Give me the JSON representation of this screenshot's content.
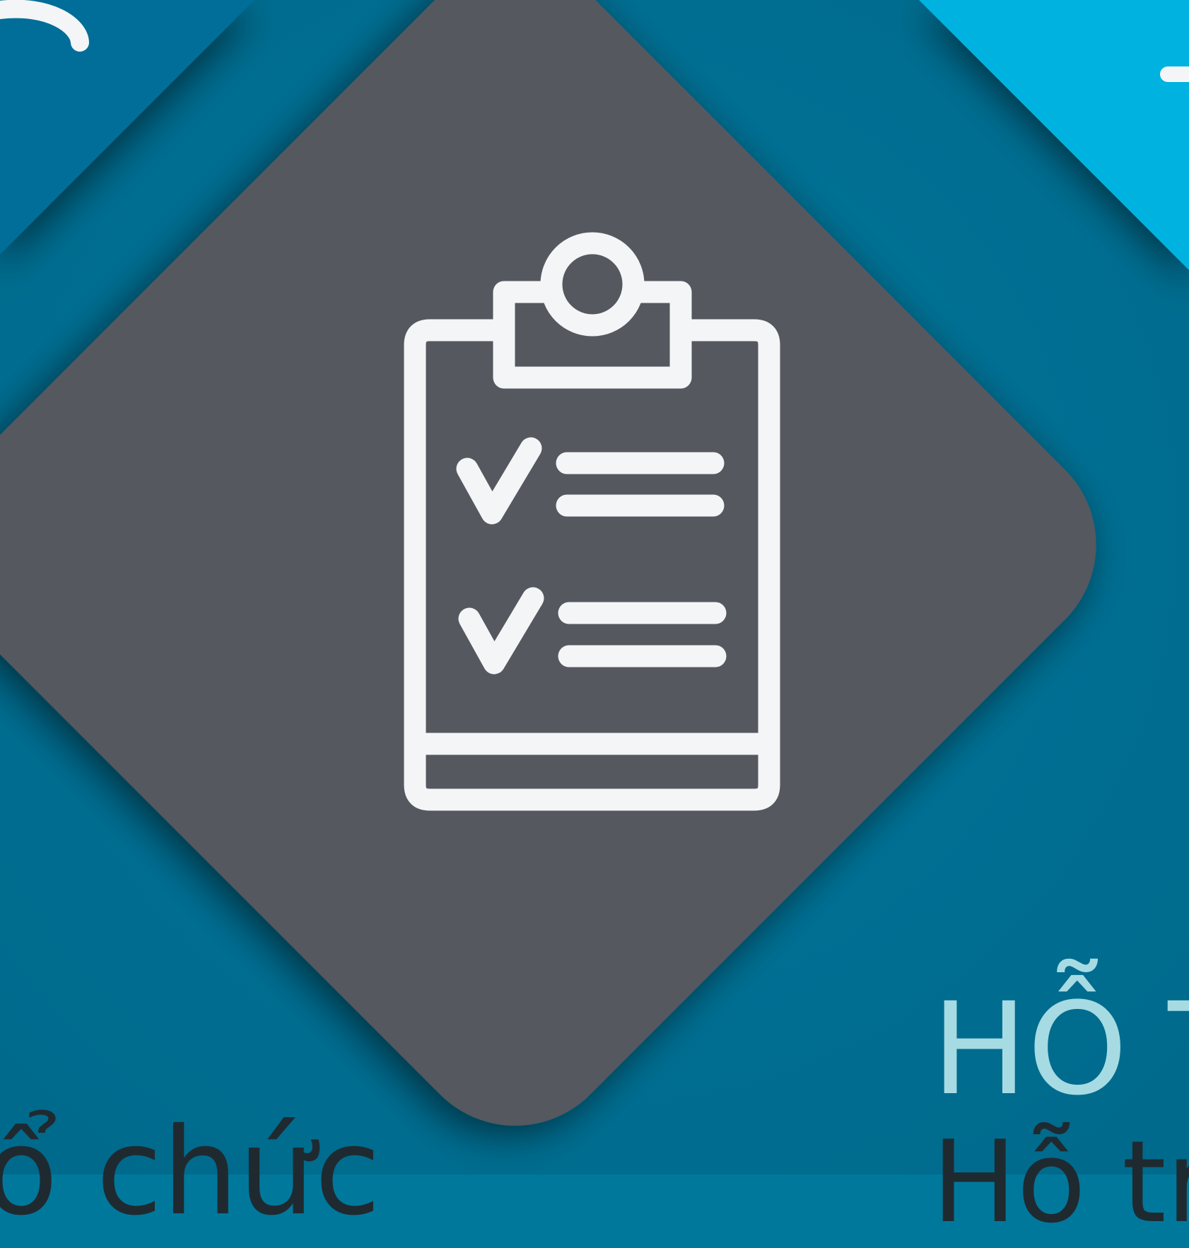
{
  "colors": {
    "background": "#00789c",
    "tile_left_top": "#056e99",
    "tile_right_top": "#00b2e0",
    "diamond": "#54595e",
    "icon_stroke": "#f4f5f7",
    "heading_accent": "#a6dbe3",
    "body_text": "#1f2a30"
  },
  "icons": {
    "main": "clipboard-checklist-icon",
    "corner_left": "arc-icon",
    "corner_right": "dash-icon"
  },
  "texts": {
    "heading_right": "HỖ T",
    "sub_right": "Hỗ tr",
    "sub_left": "ổ chức"
  }
}
